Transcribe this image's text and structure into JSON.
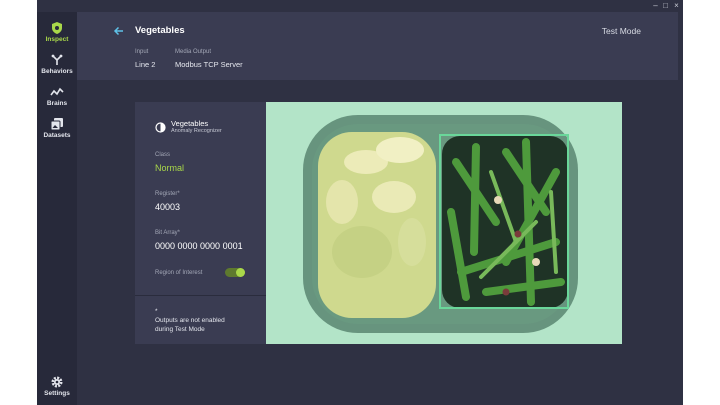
{
  "window": {
    "minimize": "–",
    "maximize": "□",
    "close": "×"
  },
  "sidebar": {
    "items": [
      {
        "label": "Inspect",
        "icon": "shield-icon",
        "active": true
      },
      {
        "label": "Behaviors",
        "icon": "branch-icon",
        "active": false
      },
      {
        "label": "Brains",
        "icon": "pulse-icon",
        "active": false
      },
      {
        "label": "Datasets",
        "icon": "image-stack-icon",
        "active": false
      }
    ],
    "settings": {
      "label": "Settings",
      "icon": "gear-icon"
    }
  },
  "header": {
    "title": "Vegetables",
    "mode": "Test Mode",
    "input_label": "Input",
    "input_value": "Line 2",
    "output_label": "Media Output",
    "output_value": "Modbus TCP Server"
  },
  "card": {
    "title": "Vegetables",
    "subtitle": "Anomaly Recognizer",
    "class_label": "Class",
    "class_value": "Normal",
    "register_label": "Register*",
    "register_value": "40003",
    "bit_array_label": "Bit Array*",
    "bit_array_value": "0000 0000 0000 0001",
    "roi_label": "Region of Interest",
    "roi_enabled": true,
    "note_star": "*",
    "note_line1": "Outputs are not enabled",
    "note_line2": "during Test Mode"
  },
  "colors": {
    "accent": "#a9d84a",
    "roi_box": "#6ad79a",
    "image_bg": "#b3e4c8"
  }
}
